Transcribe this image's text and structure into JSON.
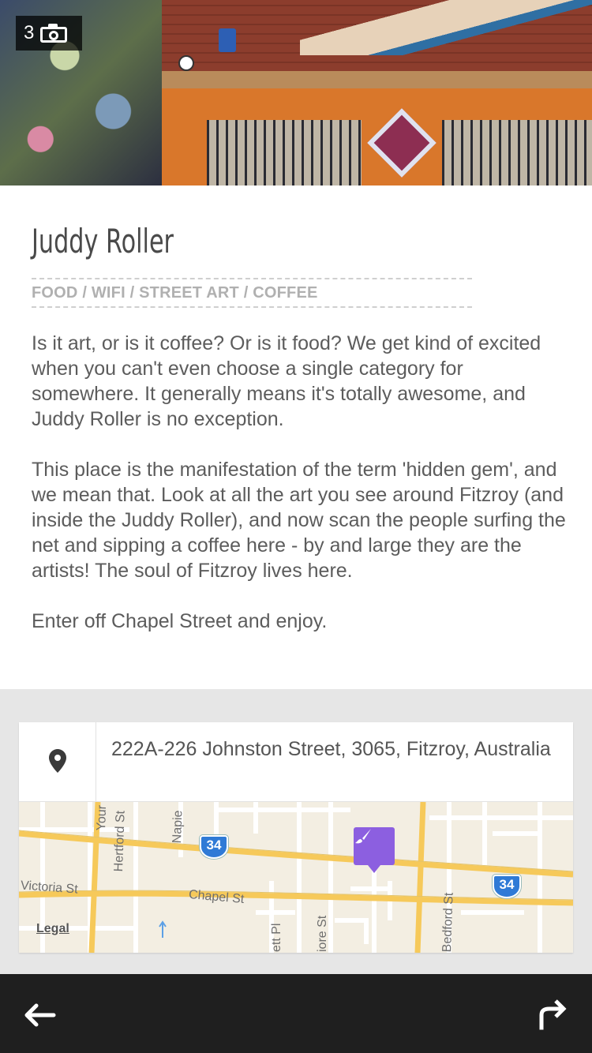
{
  "hero": {
    "photo_count": "3",
    "camera_icon": "camera-icon"
  },
  "venue": {
    "title": "Juddy Roller",
    "categories": "FOOD / WIFI / STREET ART / COFFEE",
    "description": [
      "Is it art, or is it coffee? Or is it food? We get kind of excited when you can't even choose a single category for somewhere. It generally means it's totally awesome, and Juddy Roller is no exception.",
      "This place is the manifestation of the term 'hidden gem', and we mean that. Look at all the art you see around Fitzroy (and inside the Juddy Roller), and now scan the people surfing the net and sipping a coffee here - by and large they are the artists! The soul of Fitzroy lives here.",
      "Enter off Chapel Street and enjoy."
    ]
  },
  "address": {
    "icon": "location-pin-icon",
    "text": "222A-226 Johnston Street, 3065, Fitzroy, Australia"
  },
  "map": {
    "streets": [
      "Victoria St",
      "Hertford St",
      "Napie",
      "Your",
      "Chapel St",
      "ett Pl",
      "iore St",
      "Bedford St"
    ],
    "highway_shields": [
      "34",
      "34"
    ],
    "legal": "Legal",
    "marker_icon": "paintbrush-icon",
    "colors": {
      "road": "#f6c95a",
      "land": "#f3eee2",
      "marker": "#8c5fe0",
      "shield": "#2f7ad6"
    }
  },
  "bottom_bar": {
    "back_icon": "back-arrow-icon",
    "share_icon": "share-arrow-icon"
  }
}
